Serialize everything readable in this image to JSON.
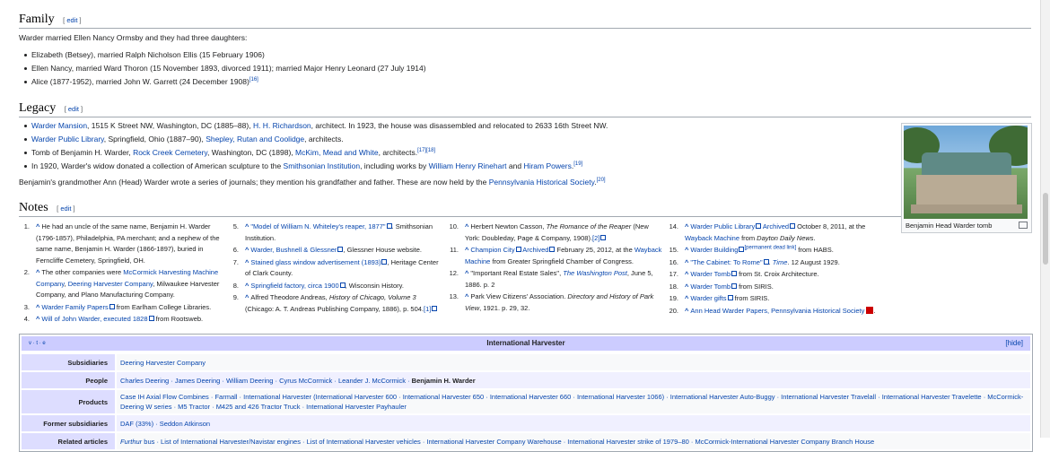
{
  "family": {
    "heading": "Family",
    "edit": "edit",
    "intro": "Warder married Ellen Nancy Ormsby and they had three daughters:",
    "items": [
      "Elizabeth (Betsey), married Ralph Nicholson Ellis (15 February 1906)",
      "Ellen Nancy, married Ward Thoron (15 November 1893, divorced 1911); married Major Henry Leonard (27 July 1914)",
      "Alice (1877-1952), married John W. Garrett (24 December 1908)"
    ],
    "alice_ref": "[16]"
  },
  "legacy": {
    "heading": "Legacy",
    "edit": "edit",
    "li1": {
      "link": "Warder Mansion",
      "text1": ", 1515 K Street NW, Washington, DC (1885–88), ",
      "link2": "H. H. Richardson",
      "text2": ", architect. In 1923, the house was disassembled and relocated to 2633 16th Street NW."
    },
    "li2": {
      "link": "Warder Public Library",
      "text1": ", Springfield, Ohio (1887–90), ",
      "link2": "Shepley, Rutan and Coolidge",
      "text2": ", architects."
    },
    "li3": {
      "text0": "Tomb of Benjamin H. Warder, ",
      "link": "Rock Creek Cemetery",
      "text1": ", Washington, DC (1898), ",
      "link2": "McKim, Mead and White",
      "text2": ", architects.",
      "ref": "[17][18]"
    },
    "li4": {
      "text0": "In 1920, Warder's widow donated a collection of American sculpture to the ",
      "link": "Smithsonian Institution",
      "text1": ", including works by ",
      "link2": "William Henry Rinehart",
      "text2": " and ",
      "link3": "Hiram Powers",
      "text3": ".",
      "ref": "[19]"
    },
    "para": "Benjamin's grandmother Ann (Head) Warder wrote a series of journals; they mention his grandfather and father. These are now held by the ",
    "para_link": "Pennsylvania Historical Society",
    "para_end": ".",
    "para_ref": "[20]",
    "thumb_caption": "Benjamin Head Warder tomb"
  },
  "notes": {
    "heading": "Notes",
    "edit": "edit",
    "n1": "He had an uncle of the same name, Benjamin H. Warder (1796-1857), Philadelphia, PA merchant; and a nephew of the same name, Benjamin H. Warder (1866-1897), buried in Ferncliffe Cemetery, Springfield, OH.",
    "n2a": "The other companies were ",
    "n2b": "McCormick Harvesting Machine Company",
    "n2c": ", ",
    "n2d": "Deering Harvester Company",
    "n2e": ", Milwaukee Harvester Company, and Plano Manufacturing Company.",
    "n3a": "Warder Family Papers",
    "n3b": " from Earlham College Libraries.",
    "n4a": "Will of John Warder, executed 1828",
    "n4b": " from Rootsweb.",
    "n5a": "\"Model of William N. Whiteley's reaper, 1877\"",
    "n5b": ". Smithsonian Institution.",
    "n6a": "Warder, Bushnell & Glessner",
    "n6b": ", Glessner House website.",
    "n7a": "Stained glass window advertisement (1893)",
    "n7b": ", Heritage Center of Clark County.",
    "n8a": "Springfield factory, circa 1900",
    "n8b": ", Wisconsin History.",
    "n9a": "Alfred Theodore Andreas, ",
    "n9b": "History of Chicago, Volume 3",
    "n9c": " (Chicago: A. T. Andreas Publishing Company, 1886), p. 504.",
    "n9d": "[1]",
    "n10a": "Herbert Newton Casson, ",
    "n10b": "The Romance of the Reaper",
    "n10c": " (New York: Doubleday, Page & Company, 1908).",
    "n10d": "[2]",
    "n11a": "Champion City",
    "n11b": "Archived",
    "n11c": " February 25, 2012, at the ",
    "n11d": "Wayback Machine",
    "n11e": " from Greater Springfield Chamber of Congress.",
    "n12a": "\"Important Real Estate Sales\", ",
    "n12b": "The Washington Post",
    "n12c": ", June 5, 1886. p. 2",
    "n13a": "Park View Citizens' Association. ",
    "n13b": "Directory and History of Park View",
    "n13c": ", 1921. p. 29, 32.",
    "n14a": "Warder Public Library",
    "n14b": "Archived",
    "n14c": " October 8, 2011, at the ",
    "n14d": "Wayback Machine",
    "n14e": " from ",
    "n14f": "Dayton Daily News",
    "n14g": ".",
    "n15a": "Warder Building",
    "n15b": "[permanent dead link]",
    "n15c": " from HABS.",
    "n16a": "\"The Cabinet: To Rome\"",
    "n16b": ". ",
    "n16c": "Time",
    "n16d": ". 12 August 1929.",
    "n17a": "Warder Tomb",
    "n17b": " from St. Croix Architecture.",
    "n18a": "Warder Tomb",
    "n18b": " from SIRIS.",
    "n19a": "Warder gifts",
    "n19b": " from SIRIS.",
    "n20a": "Ann Head Warder Papers, Pennsylvania Historical Society"
  },
  "navbox": {
    "vte": "v · t · e",
    "title": "International Harvester",
    "hide": "[hide]",
    "rows": {
      "subsidiaries": {
        "label": "Subsidiaries",
        "value": "Deering Harvester Company"
      },
      "people": {
        "label": "People",
        "links": "Charles Deering · James Deering · William Deering · Cyrus McCormick · Leander J. McCormick · ",
        "bold": "Benjamin H. Warder"
      },
      "products": {
        "label": "Products",
        "value": "Case IH Axial Flow Combines · Farmall · International Harvester (International Harvester 600 · International Harvester 650 · International Harvester 660 · International Harvester 1066) · International Harvester Auto-Buggy · International Harvester Travelall · International Harvester Travelette · McCormick-Deering W series · M5 Tractor · M425 and 426 Tractor Truck · International Harvester Payhauler"
      },
      "former": {
        "label": "Former subsidiaries",
        "value": "DAF (33%) · Seddon Atkinson"
      },
      "related": {
        "label": "Related articles",
        "italic": "Furthur",
        "value": " bus · List of International Harvester/Navistar engines · List of International Harvester vehicles · International Harvester Company Warehouse · International Harvester strike of 1979–80 · McCormick-International Harvester Company Branch House"
      }
    }
  }
}
